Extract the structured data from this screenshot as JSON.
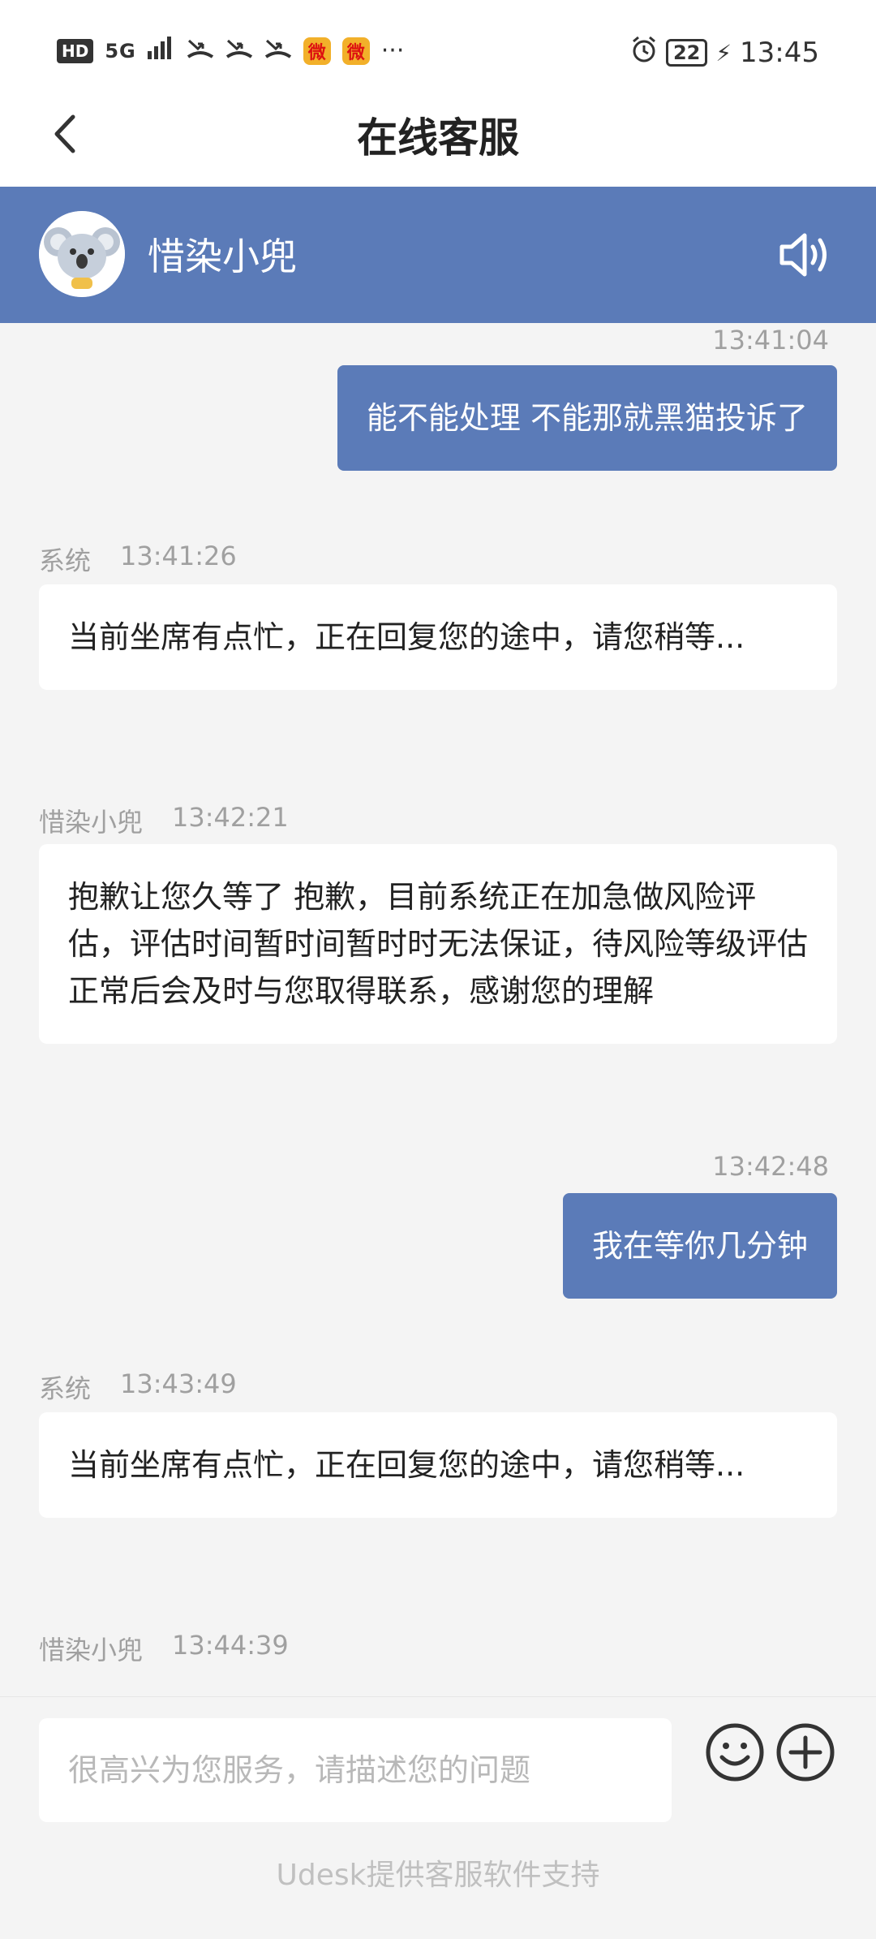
{
  "status_bar": {
    "left": {
      "hd": "HD",
      "signal": "5G",
      "app_icon": "微",
      "dots": "···"
    },
    "right": {
      "battery": "22",
      "time": "13:45"
    }
  },
  "title_bar": {
    "title": "在线客服",
    "back_icon": "chevron-left-icon"
  },
  "agent": {
    "name": "惜染小兜",
    "avatar_icon": "koala-avatar-icon",
    "speaker_icon": "speaker-icon"
  },
  "messages": [
    {
      "side": "right",
      "time": "13:41:04",
      "text": "能不能处理 不能那就黑猫投诉了"
    },
    {
      "side": "left",
      "sender": "系统",
      "time": "13:41:26",
      "text": "当前坐席有点忙，正在回复您的途中，请您稍等..."
    },
    {
      "side": "left",
      "sender": "惜染小兜",
      "time": "13:42:21",
      "text": "抱歉让您久等了 抱歉，目前系统正在加急做风险评估，评估时间暂时间暂时时无法保证，待风险等级评估正常后会及时与您取得联系，感谢您的理解"
    },
    {
      "side": "right",
      "time": "13:42:48",
      "text": "我在等你几分钟"
    },
    {
      "side": "left",
      "sender": "系统",
      "time": "13:43:49",
      "text": "当前坐席有点忙，正在回复您的途中，请您稍等..."
    },
    {
      "side": "left",
      "sender": "惜染小兜",
      "time": "13:44:39",
      "text": ""
    }
  ],
  "input": {
    "placeholder": "很高兴为您服务，请描述您的问题",
    "value": ""
  },
  "footer": {
    "text": "Udesk提供客服软件支持"
  },
  "colors": {
    "accent": "#5b7bb8",
    "background": "#f4f4f4"
  }
}
